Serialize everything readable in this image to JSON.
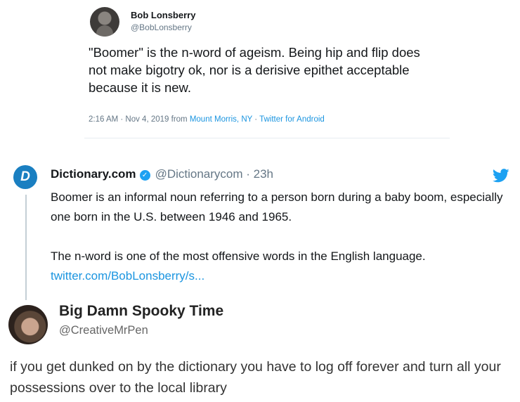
{
  "top_tweet": {
    "name": "Bob Lonsberry",
    "handle": "@BobLonsberry",
    "text": "\"Boomer\" is the n-word of ageism. Being hip and flip does not make bigotry ok, nor is a derisive epithet acceptable because it is new.",
    "time": "2:16 AM · Nov 4, 2019 from ",
    "location": "Mount Morris, NY",
    "separator": " · ",
    "source": "Twitter for Android"
  },
  "dictionary_reply": {
    "name": "Dictionary.com",
    "handle": "@Dictionarycom",
    "separator": " · ",
    "time": "23h",
    "paragraph1": "Boomer is an informal noun referring to a person born during a baby boom, especially one born in the U.S. between 1946 and 1965.",
    "paragraph2_text": "The n-word is one of the most offensive words in the English language. ",
    "paragraph2_link": "twitter.com/BobLonsberry/s...",
    "icon": "twitter-bird-icon",
    "verified_icon": "verified-badge-icon"
  },
  "tumblr_post": {
    "name": "Big Damn Spooky Time",
    "handle": "@CreativeMrPen",
    "text": "if you get dunked on by the dictionary you have to log off forever and turn all your possessions over to the local library"
  },
  "colors": {
    "link": "#1b95e0",
    "twitter_blue": "#1da1f2",
    "dictionary_blue": "#1a7fc1",
    "muted": "#657786"
  }
}
